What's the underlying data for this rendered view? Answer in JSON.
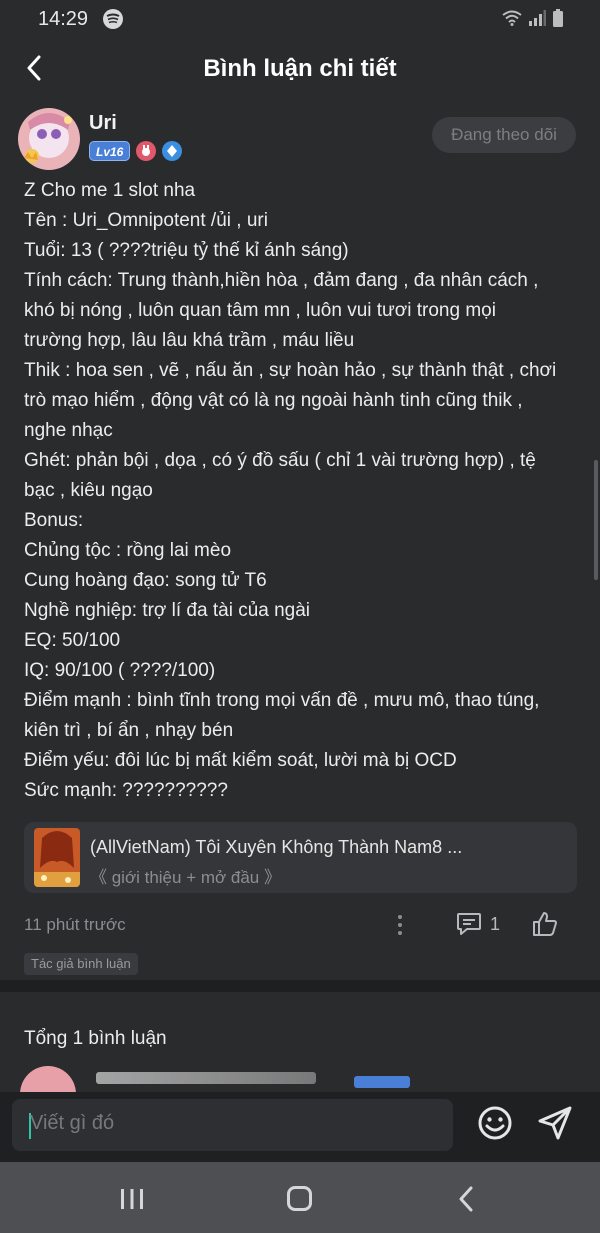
{
  "status_bar": {
    "time": "14:29"
  },
  "header": {
    "title": "Bình luận chi tiết"
  },
  "comment": {
    "username": "Uri",
    "level": "Lv16",
    "follow_label": "Đang theo dõi",
    "lines": [
      "Z Cho me 1 slot nha",
      "Tên : Uri_Omnipotent /ủi , uri",
      "Tuổi: 13 ( ????triệu tỷ thế kỉ ánh sáng)",
      "Tính cách: Trung thành,hiền hòa , đảm đang , đa nhân cách ,",
      "khó bị nóng , luôn quan tâm mn , luôn vui tươi trong mọi",
      "trường hợp, lâu lâu khá trầm , máu liều",
      "Thik : hoa sen , vẽ , nấu ăn , sự hoàn hảo , sự thành thật , chơi",
      "trò mạo hiểm , động vật có là ng ngoài hành tinh cũng thik ,",
      "nghe nhạc",
      "Ghét: phản bội , dọa , có ý đồ sấu ( chỉ 1 vài trường hợp) , tệ",
      "bạc , kiêu ngạo",
      "Bonus:",
      "Chủng tộc : rồng lai mèo",
      "Cung hoàng đạo: song tử T6",
      "Nghề nghiệp: trợ lí đa tài của ngài",
      "EQ: 50/100",
      "IQ: 90/100 ( ????/100)",
      "Điểm mạnh : bình tĩnh trong mọi vấn đề , mưu mô, thao túng,",
      "kiên trì , bí ẩn , nhạy bén",
      "Điểm yếu: đôi lúc bị mất kiểm soát, lười mà bị OCD",
      "Sức mạnh: ??????????"
    ],
    "story": {
      "title": "(AllVietNam) Tôi Xuyên Không Thành Nam8 ...",
      "subtitle": "《 giới thiệu + mở đầu 》"
    },
    "time_ago": "11 phút trước",
    "reply_count": "1",
    "author_tag": "Tác giả bình luận"
  },
  "replies": {
    "total_label": "Tổng 1 bình luận"
  },
  "input": {
    "placeholder": "Viết gì đó"
  },
  "icons": {
    "back": "chevron-left-icon",
    "more": "more-vertical-icon",
    "reply": "comment-icon",
    "like": "thumbs-up-icon",
    "emoji": "smile-icon",
    "send": "send-icon"
  },
  "colors": {
    "background": "#2a2b2d",
    "level_badge": "#4a7fd8",
    "caret": "#2ec4a6"
  }
}
